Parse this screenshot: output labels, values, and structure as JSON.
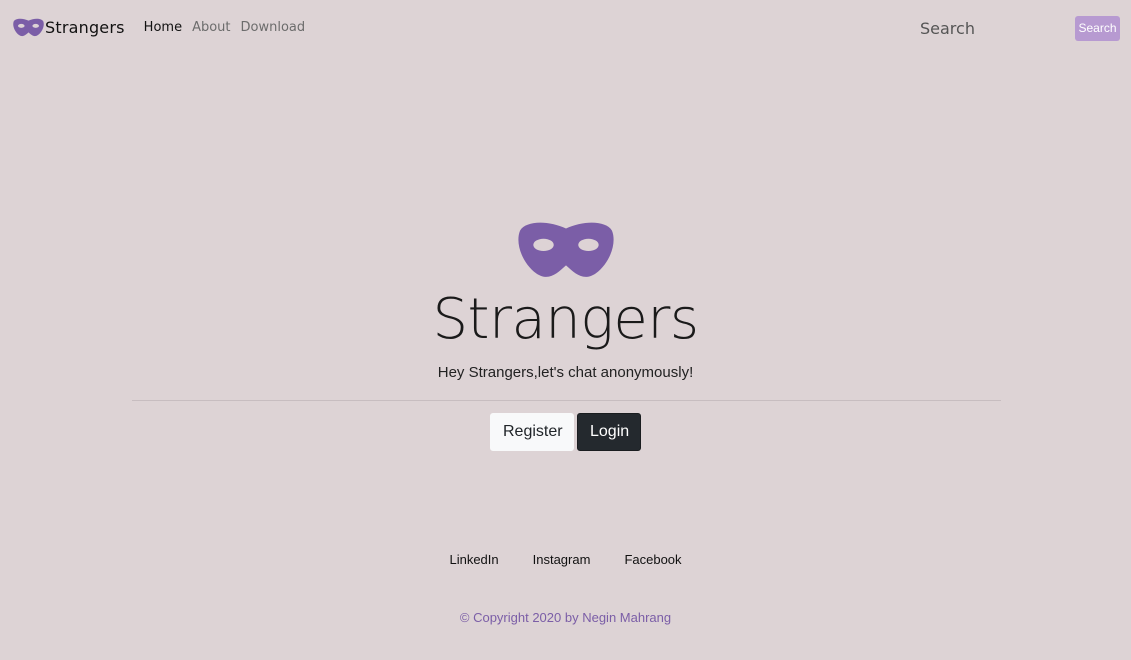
{
  "navbar": {
    "brand": "Strangers",
    "links": [
      {
        "label": "Home"
      },
      {
        "label": "About"
      },
      {
        "label": "Download"
      }
    ],
    "search_placeholder": "Search",
    "search_button": "Search"
  },
  "hero": {
    "title": "Strangers",
    "subtitle": "Hey Strangers,let's chat anonymously!",
    "register_label": "Register",
    "login_label": "Login"
  },
  "footer": {
    "social": [
      {
        "label": "LinkedIn"
      },
      {
        "label": "Instagram"
      },
      {
        "label": "Facebook"
      }
    ],
    "copyright": "© Copyright 2020 by Negin Mahrang"
  },
  "colors": {
    "background": "#ddd3d5",
    "accent": "#7b5ea7",
    "search_button": "#b79ad1",
    "login_button": "#24292e"
  }
}
